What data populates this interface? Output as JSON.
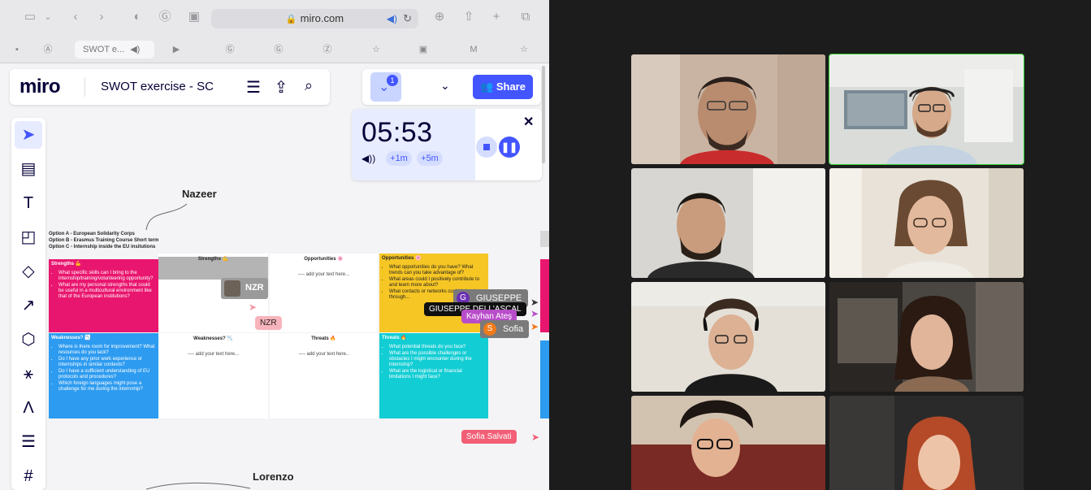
{
  "browser": {
    "url": "miro.com",
    "tabs": [
      {
        "label": "SWOT e...",
        "audio_icon": "speaker-icon",
        "active": true
      }
    ],
    "tab_icons": [
      "tab-grid-icon",
      "tab-a-icon",
      "tab-youtube-icon",
      "tab-g-icon",
      "tab-g2-icon",
      "tab-z-icon",
      "tab-star-icon",
      "tab-img-icon",
      "tab-gmail-icon",
      "tab-star2-icon"
    ]
  },
  "miro": {
    "logo": "miro",
    "board_name": "SWOT exercise - SC",
    "collaborators_badge": "1",
    "share_label": "Share",
    "timer": {
      "time": "05:53",
      "plus1": "+1m",
      "plus5": "+5m"
    },
    "board": {
      "name_top": "Nazeer",
      "name_bottom": "Lorenzo",
      "options": [
        "Option A - European Solidarity Corps",
        "Option B - Erasmus Training Course Short term",
        "Option C - Internship inside the EU insitutions"
      ],
      "strengths": {
        "title": "Strengths 💪",
        "bullets": [
          "What specific skills can I bring to the internship/training/volunteering opportunity?",
          "What are my personal strengths that could be useful in a multicultural environment like that of the European institutions?"
        ]
      },
      "strengths_center": {
        "title": "Strengths 💪"
      },
      "opportunities_center": {
        "title": "Opportunities 🌸",
        "add": "---- add your text here..."
      },
      "opportunities": {
        "title": "Opportunities 🌸",
        "bullets": [
          "What opportunities do you have? What trends can you take advantage of?",
          "What areas could I positively contribute to and learn more about?",
          "What contacts or networks could I develop through..."
        ]
      },
      "weaknesses": {
        "title": "Weaknesses? 📉",
        "bullets": [
          "Where is there room for improvement? What resources do you lack?",
          "Do I have any prior work experience or internships in similar contexts?",
          "Do I have a sufficient understanding of EU protocols and procedures?",
          "Which foreign languages might pose a challenge for me during the internship?"
        ]
      },
      "weaknesses_center": {
        "title": "Weaknesses? 📉",
        "add": "---- add your text here..."
      },
      "threats_center": {
        "title": "Threats 🔥",
        "add": "---- add your text here.."
      },
      "threats": {
        "title": "Threats 🔥",
        "bullets": [
          "What potential threats do you face?",
          "What are the possible challenges or obstacles I might encounter during the internship?",
          "What are the logistical or financial limitations I might face?"
        ]
      }
    },
    "cursors": {
      "nzr_video": "NZR",
      "nzr": "NZR",
      "giuseppe_initial": "G",
      "giuseppe_short": "GIUSEPPE",
      "giuseppe_full": "GIUSEPPE DELL'ASCAL",
      "kayhan": "Kayhan Ateş",
      "sofia_initial": "S",
      "sofia": "Sofia",
      "sofia_salvati": "Sofia Salvati"
    },
    "colors": {
      "accent": "#4255ff",
      "strengths": "#e9166f",
      "weaknesses": "#2d9bf0",
      "opportunities": "#f6c625",
      "threats": "#13cdd4",
      "header_gray": "#b4b4b4"
    }
  },
  "call": {
    "participants": [
      {
        "role": "participant",
        "speaking": false
      },
      {
        "role": "participant",
        "speaking": true
      },
      {
        "role": "participant",
        "speaking": false
      },
      {
        "role": "participant",
        "speaking": false
      },
      {
        "role": "participant",
        "speaking": false
      },
      {
        "role": "participant",
        "speaking": false
      },
      {
        "role": "participant",
        "speaking": false
      },
      {
        "role": "participant",
        "speaking": false
      }
    ]
  }
}
